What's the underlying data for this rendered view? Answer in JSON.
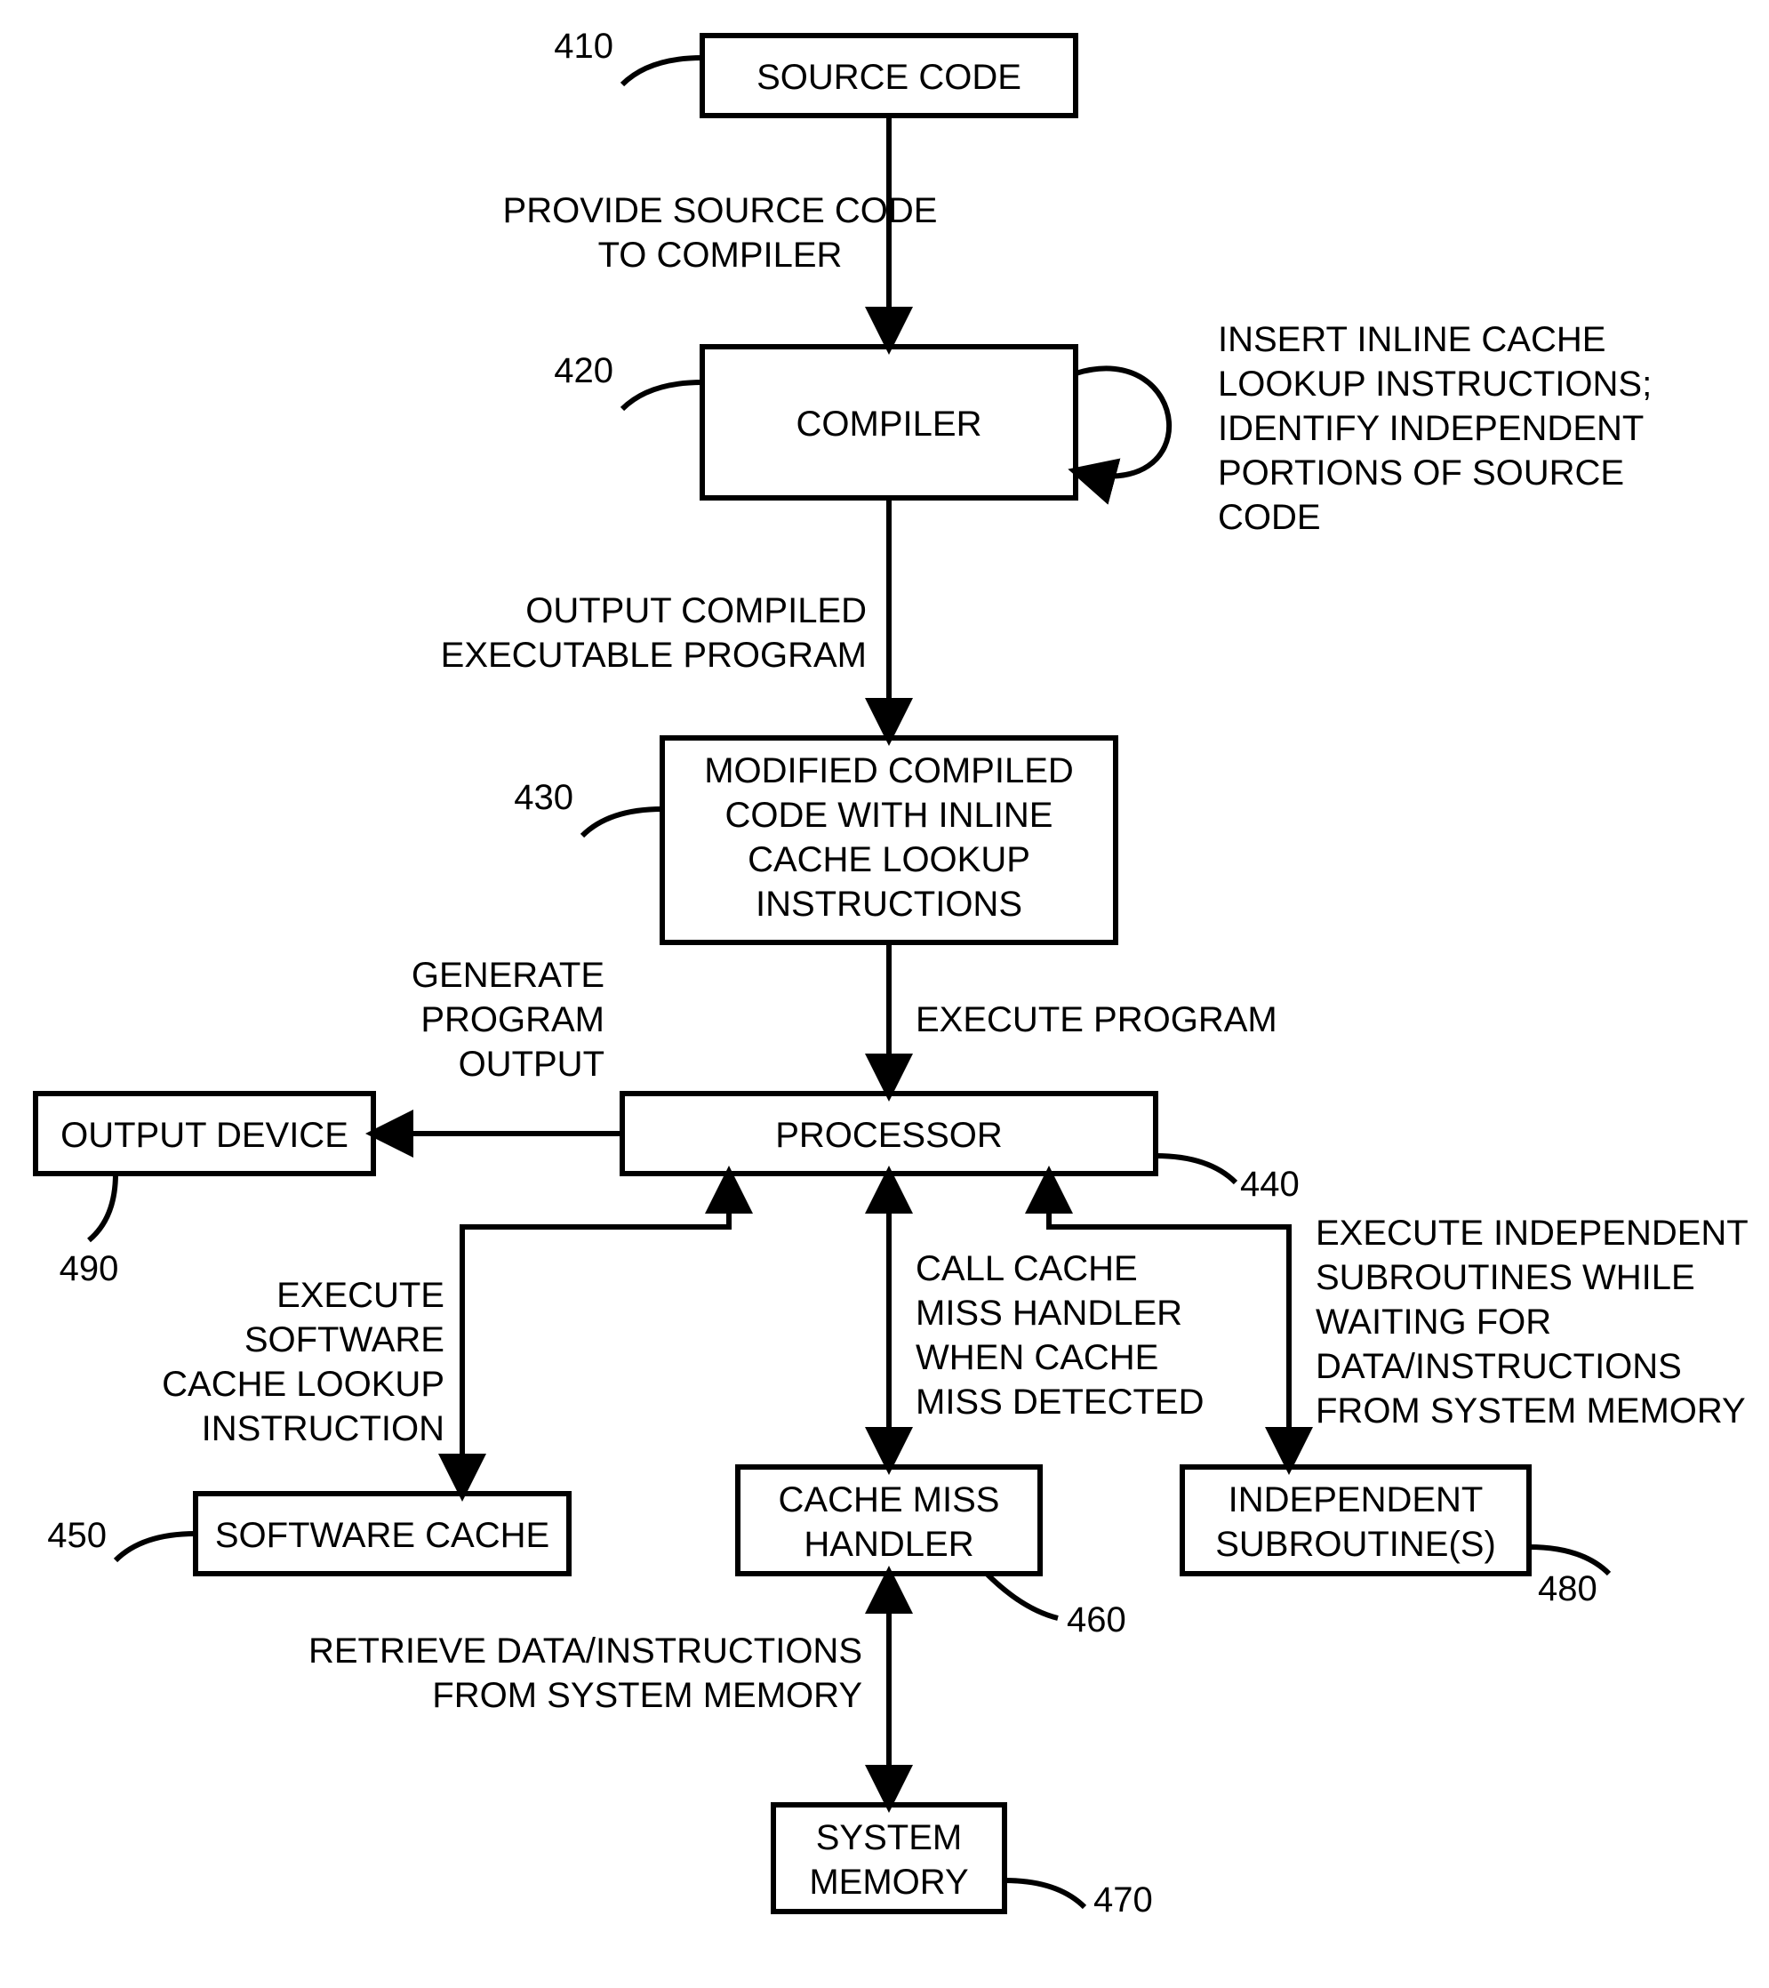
{
  "boxes": {
    "source_code": {
      "label": "SOURCE CODE",
      "ref": "410"
    },
    "compiler": {
      "label": "COMPILER",
      "ref": "420"
    },
    "modified": {
      "l1": "MODIFIED COMPILED",
      "l2": "CODE WITH INLINE",
      "l3": "CACHE LOOKUP",
      "l4": "INSTRUCTIONS",
      "ref": "430"
    },
    "processor": {
      "label": "PROCESSOR",
      "ref": "440"
    },
    "output_device": {
      "label": "OUTPUT DEVICE",
      "ref": "490"
    },
    "software_cache": {
      "label": "SOFTWARE CACHE",
      "ref": "450"
    },
    "cache_miss_handler": {
      "l1": "CACHE MISS",
      "l2": "HANDLER",
      "ref": "460"
    },
    "independent_sub": {
      "l1": "INDEPENDENT",
      "l2": "SUBROUTINE(S)",
      "ref": "480"
    },
    "system_memory": {
      "l1": "SYSTEM",
      "l2": "MEMORY",
      "ref": "470"
    }
  },
  "edges": {
    "src_to_compiler": {
      "l1": "PROVIDE SOURCE CODE",
      "l2": "TO COMPILER"
    },
    "compiler_self": {
      "l1": "INSERT INLINE CACHE",
      "l2": "LOOKUP INSTRUCTIONS;",
      "l3": "IDENTIFY INDEPENDENT",
      "l4": "PORTIONS OF SOURCE",
      "l5": "CODE"
    },
    "compiler_to_modified": {
      "l1": "OUTPUT COMPILED",
      "l2": "EXECUTABLE PROGRAM"
    },
    "modified_to_processor": {
      "l1": "EXECUTE PROGRAM"
    },
    "processor_to_output": {
      "l1": "GENERATE",
      "l2": "PROGRAM",
      "l3": "OUTPUT"
    },
    "processor_to_swcache": {
      "l1": "EXECUTE",
      "l2": "SOFTWARE",
      "l3": "CACHE LOOKUP",
      "l4": "INSTRUCTION"
    },
    "processor_to_cmh": {
      "l1": "CALL CACHE",
      "l2": "MISS HANDLER",
      "l3": "WHEN CACHE",
      "l4": "MISS DETECTED"
    },
    "processor_to_indep": {
      "l1": "EXECUTE INDEPENDENT",
      "l2": "SUBROUTINES WHILE",
      "l3": "WAITING FOR",
      "l4": "DATA/INSTRUCTIONS",
      "l5": "FROM SYSTEM MEMORY"
    },
    "cmh_to_sysmem": {
      "l1": "RETRIEVE DATA/INSTRUCTIONS",
      "l2": "FROM SYSTEM MEMORY"
    }
  }
}
